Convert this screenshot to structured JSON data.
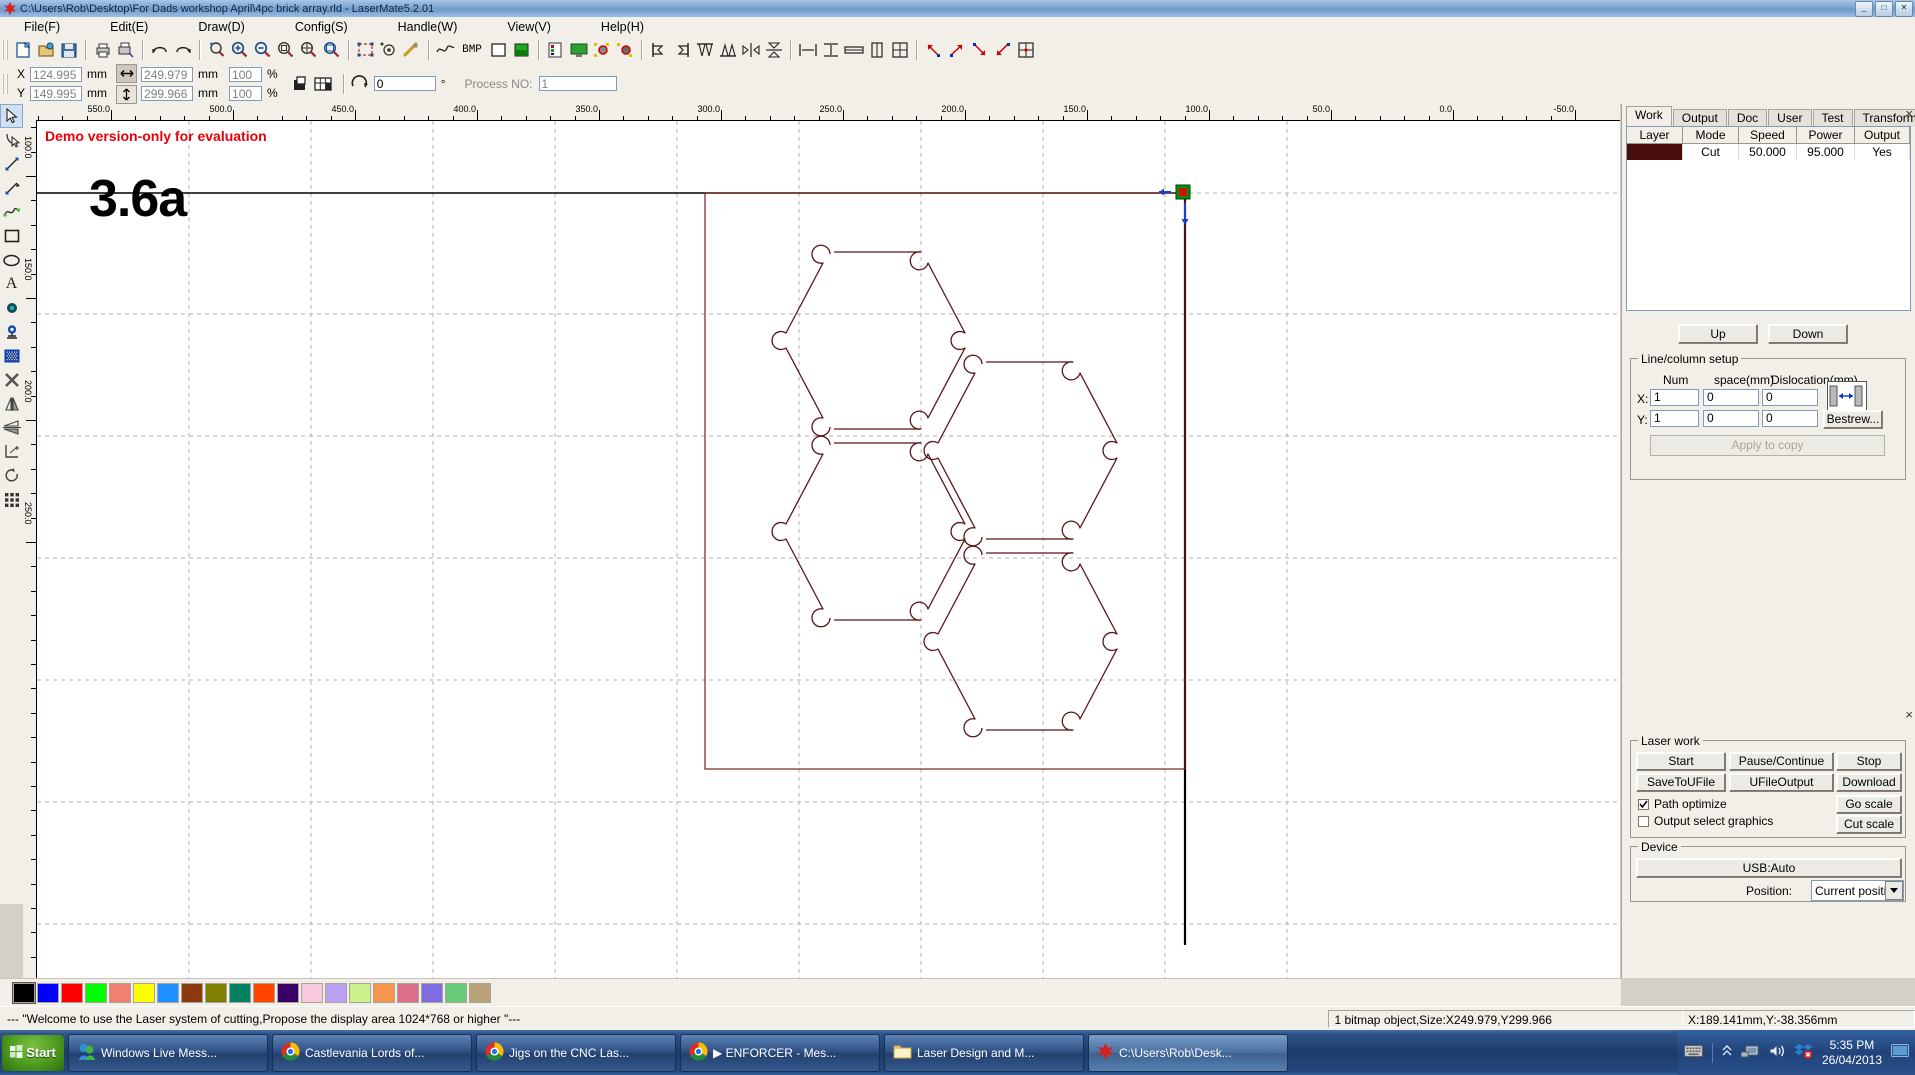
{
  "window": {
    "title": "C:\\Users\\Rob\\Desktop\\For Dads workshop April\\4pc brick array.rld - LaserMate5.2.01",
    "minimize": "_",
    "maximize": "□",
    "close": "✕"
  },
  "menu": [
    {
      "label": "File(F)"
    },
    {
      "label": "Edit(E)"
    },
    {
      "label": "Draw(D)"
    },
    {
      "label": "Config(S)"
    },
    {
      "label": "Handle(W)"
    },
    {
      "label": "View(V)"
    },
    {
      "label": "Help(H)"
    }
  ],
  "toolbar1": {
    "icons": [
      "new-file-icon",
      "open-file-icon",
      "save-file-icon",
      "print-icon",
      "print-preview-icon",
      "undo-icon",
      "redo-icon",
      "zoom-select-icon",
      "zoom-in-icon",
      "zoom-out-icon",
      "zoom-window-icon",
      "zoom-all-icon",
      "zoom-extents-icon",
      "select-frame-icon",
      "origin-icon",
      "measure-icon",
      "curve-icon",
      "bmp-icon",
      "rect-fill-icon",
      "bitmap-color-icon",
      "invert-color-icon",
      "screen-icon",
      "node-edit-icon",
      "node-delete-icon",
      "align-left-icon",
      "align-right-icon",
      "align-top-icon",
      "align-bottom-icon",
      "align-center-h-icon",
      "align-center-v-icon",
      "dist-h-icon",
      "dist-v-icon",
      "size-h-icon",
      "size-v-icon",
      "size-both-icon",
      "anchor-tl-icon",
      "anchor-tr-icon",
      "anchor-br-icon",
      "anchor-bl-icon",
      "anchor-center-icon"
    ],
    "bmp_label": "BMP"
  },
  "toolbar2": {
    "x_label": "X",
    "y_label": "Y",
    "x_value": "124.995",
    "y_value": "149.995",
    "x_unit": "mm",
    "y_unit": "mm",
    "width_value": "249.979",
    "height_value": "299.966",
    "width_unit": "mm",
    "height_unit": "mm",
    "scale_x": "100",
    "scale_y": "100",
    "percent": "%",
    "angle_value": "0",
    "angle_unit": "°",
    "process_label": "Process NO:",
    "process_value": "1"
  },
  "lefttools": [
    {
      "name": "select-arrow-tool",
      "selected": true
    },
    {
      "name": "node-edit-tool",
      "selected": false
    },
    {
      "name": "line-tool",
      "selected": false
    },
    {
      "name": "polyline-tool",
      "selected": false
    },
    {
      "name": "bezier-curve-tool",
      "selected": false
    },
    {
      "name": "rectangle-tool",
      "selected": false
    },
    {
      "name": "ellipse-tool",
      "selected": false
    },
    {
      "name": "text-tool",
      "selected": false
    },
    {
      "name": "point-tool",
      "selected": false
    },
    {
      "name": "capture-tool",
      "selected": false
    },
    {
      "name": "bitmap-tool",
      "selected": false
    },
    {
      "name": "delete-tool",
      "selected": false
    },
    {
      "name": "mirror-horizontal-tool",
      "selected": false
    },
    {
      "name": "mirror-vertical-tool",
      "selected": false
    },
    {
      "name": "offset-tool",
      "selected": false
    },
    {
      "name": "rotate-tool",
      "selected": false
    },
    {
      "name": "array-tool",
      "selected": false
    }
  ],
  "canvas": {
    "demo_notice": "Demo version-only for evaluation",
    "part_label": "3.6a",
    "h_ruler_labels": [
      "550.0",
      "500.0",
      "450.0",
      "400.0",
      "350.0",
      "300.0",
      "250.0",
      "200.0",
      "150.0",
      "100.0",
      "50.0",
      "0.0",
      "-50.0"
    ],
    "v_ruler_labels": [
      "100.0",
      "150.0",
      "200.0",
      "250.0"
    ],
    "object_outline_color": "#5a1414",
    "grid_color": "#b0b0b0"
  },
  "palette": {
    "colors": [
      "#000000",
      "#0000ff",
      "#ff0000",
      "#00ff00",
      "#f08070",
      "#ffff00",
      "#1e90ff",
      "#8b3a10",
      "#808000",
      "#008060",
      "#ff4500",
      "#3b0068",
      "#f8c8dc",
      "#b9a0f0",
      "#ccf08c",
      "#f7944d",
      "#dd6e8c",
      "#7f6ce0",
      "#66cc77",
      "#b9a179"
    ]
  },
  "rightpanel": {
    "tabs": [
      {
        "label": "Work",
        "active": true
      },
      {
        "label": "Output",
        "active": false
      },
      {
        "label": "Doc",
        "active": false
      },
      {
        "label": "User",
        "active": false
      },
      {
        "label": "Test",
        "active": false
      },
      {
        "label": "Transform",
        "active": false
      }
    ],
    "layer_table": {
      "headers": [
        "Layer",
        "Mode",
        "Speed",
        "Power",
        "Output"
      ],
      "rows": [
        {
          "layer_color": "#4a0d0d",
          "mode": "Cut",
          "speed": "50.000",
          "power": "95.000",
          "output": "Yes"
        }
      ]
    },
    "up_label": "Up",
    "down_label": "Down",
    "linecolumn": {
      "title": "Line/column setup",
      "col_headers": [
        "Num",
        "space(mm)",
        "Dislocation(mm)"
      ],
      "x_label": "X:",
      "y_label": "Y:",
      "x_num": "1",
      "x_space": "0",
      "x_dislocation": "0",
      "y_num": "1",
      "y_space": "0",
      "y_dislocation": "0",
      "bestrew_label": "Bestrew...",
      "apply_label": "Apply to copy"
    },
    "laserwork": {
      "title": "Laser work",
      "start": "Start",
      "pause": "Pause/Continue",
      "stop": "Stop",
      "save_to_ufile": "SaveToUFile",
      "ufile_output": "UFileOutput",
      "download": "Download",
      "path_optimize": "Path optimize",
      "path_optimize_checked": true,
      "output_select_graphics": "Output select graphics",
      "output_select_checked": false,
      "go_scale": "Go scale",
      "cut_scale": "Cut scale"
    },
    "device": {
      "title": "Device",
      "connection": "USB:Auto",
      "position_label": "Position:",
      "position_value": "Current positic"
    }
  },
  "statusbar": {
    "message": "--- \"Welcome to use the Laser system of cutting,Propose the display area 1024*768 or higher \"---",
    "object_info": "1 bitmap object,Size:X249.979,Y299.966",
    "cursor_coords": "X:189.141mm,Y:-38.356mm"
  },
  "taskbar": {
    "start_label": "Start",
    "items": [
      {
        "label": "Windows Live Mess...",
        "icon": "messenger-icon",
        "active": false
      },
      {
        "label": "Castlevania Lords of...",
        "icon": "chrome-icon",
        "active": false
      },
      {
        "label": "Jigs on the CNC Las...",
        "icon": "chrome-icon",
        "active": false
      },
      {
        "label": "▶ ENFORCER - Mes...",
        "icon": "chrome-icon",
        "active": false
      },
      {
        "label": "Laser Design and M...",
        "icon": "folder-icon",
        "active": false
      },
      {
        "label": "C:\\Users\\Rob\\Desk...",
        "icon": "lasermate-icon",
        "active": true
      }
    ],
    "tray_icons": [
      "keyboard-icon",
      "show-hidden-icon",
      "network-icon",
      "volume-icon",
      "dropbox-error-icon",
      "show-desktop-icon"
    ],
    "time": "5:35 PM",
    "date": "26/04/2013"
  }
}
